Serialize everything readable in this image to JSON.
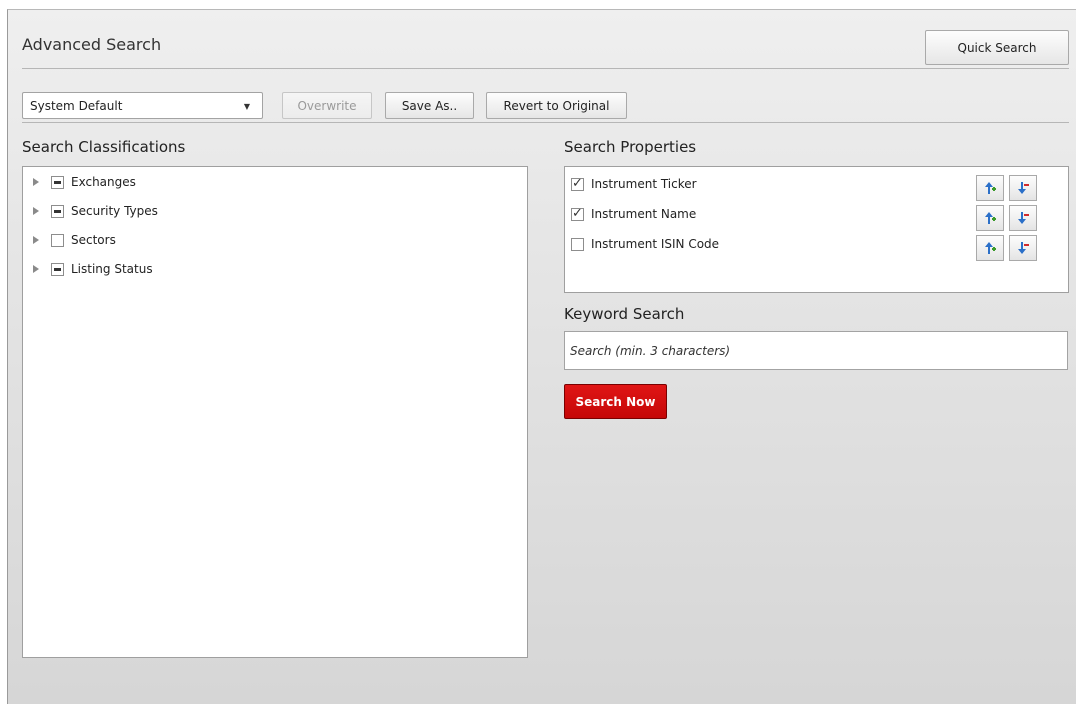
{
  "header": {
    "title": "Advanced Search",
    "quick_search_label": "Quick Search"
  },
  "toolbar": {
    "profile_selected": "System Default",
    "overwrite_label": "Overwrite",
    "save_as_label": "Save As..",
    "revert_label": "Revert to Original"
  },
  "classifications": {
    "title": "Search Classifications",
    "items": [
      {
        "label": "Exchanges",
        "state": "partial"
      },
      {
        "label": "Security Types",
        "state": "partial"
      },
      {
        "label": "Sectors",
        "state": "unchecked"
      },
      {
        "label": "Listing Status",
        "state": "partial"
      }
    ]
  },
  "properties": {
    "title": "Search Properties",
    "items": [
      {
        "label": "Instrument Ticker",
        "checked": true
      },
      {
        "label": "Instrument Name",
        "checked": true
      },
      {
        "label": "Instrument ISIN Code",
        "checked": false
      }
    ]
  },
  "keyword": {
    "title": "Keyword Search",
    "placeholder": "Search (min. 3 characters)"
  },
  "search_now_label": "Search Now",
  "colors": {
    "accent_red": "#d10a0a",
    "move_up_green": "#3a9a2a",
    "move_down_red": "#d22b2b",
    "arrow_blue": "#2b6fc8"
  }
}
